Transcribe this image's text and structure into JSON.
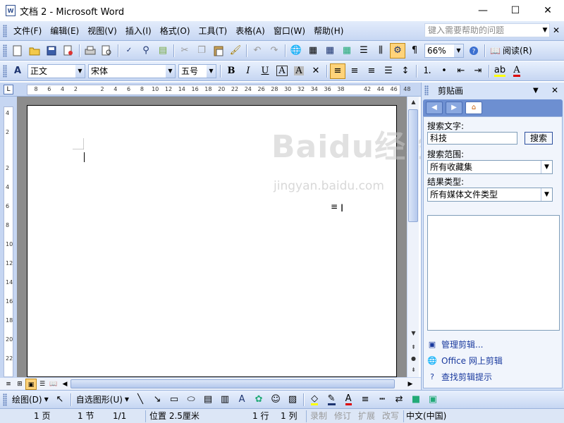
{
  "window": {
    "title": "文档 2 - Microsoft Word",
    "minimize": "—",
    "maximize": "☐",
    "close": "✕"
  },
  "menubar": {
    "items": [
      "文件(F)",
      "编辑(E)",
      "视图(V)",
      "插入(I)",
      "格式(O)",
      "工具(T)",
      "表格(A)",
      "窗口(W)",
      "帮助(H)"
    ],
    "help_placeholder": "键入需要帮助的问题"
  },
  "standard_toolbar": {
    "zoom": "66%",
    "read_label": "阅读(R)"
  },
  "format_toolbar": {
    "style": "正文",
    "font": "宋体",
    "size": "五号"
  },
  "ruler": {
    "top_numbers": [
      "8",
      "6",
      "4",
      "2",
      "2",
      "4",
      "6",
      "8",
      "10",
      "12",
      "14",
      "16",
      "18",
      "20",
      "22",
      "24",
      "26",
      "28",
      "30",
      "32",
      "34",
      "36",
      "38",
      "42",
      "44",
      "46",
      "48"
    ],
    "left_numbers": [
      "4",
      "2",
      "2",
      "4",
      "6",
      "8",
      "10",
      "12",
      "14",
      "16",
      "18",
      "20",
      "22"
    ]
  },
  "taskpane": {
    "title": "剪贴画",
    "search_label": "搜索文字:",
    "search_value": "科技",
    "search_button": "搜索",
    "scope_label": "搜索范围:",
    "scope_value": "所有收藏集",
    "type_label": "结果类型:",
    "type_value": "所有媒体文件类型",
    "links": [
      "管理剪辑...",
      "Office 网上剪辑",
      "查找剪辑提示"
    ]
  },
  "drawing_toolbar": {
    "draw_label": "绘图(D)",
    "autoshapes_label": "自选图形(U)"
  },
  "statusbar": {
    "page": "1 页",
    "section": "1 节",
    "page_of": "1/1",
    "position": "位置 2.5厘米",
    "line": "1 行",
    "column": "1 列",
    "rec": "录制",
    "trk": "修订",
    "ext": "扩展",
    "ovr": "改写",
    "language": "中文(中国)"
  },
  "watermark": {
    "main": "Baidu经验",
    "sub": "jingyan.baidu.com"
  }
}
